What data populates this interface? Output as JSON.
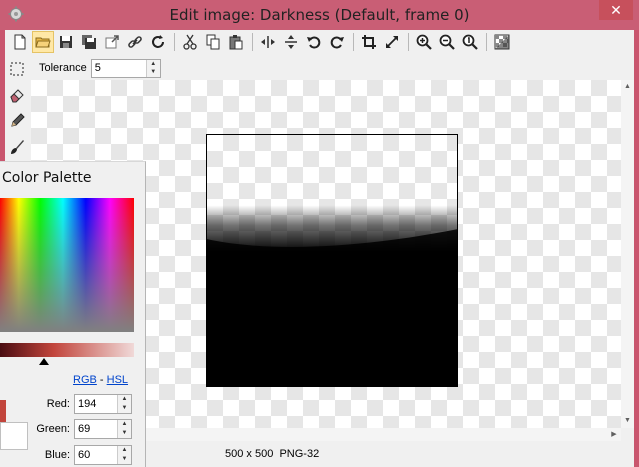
{
  "window": {
    "title": "Edit image: Darkness (Default, frame 0)",
    "close_glyph": "✕"
  },
  "toolbar": {
    "buttons": [
      {
        "icon": "new-file-icon"
      },
      {
        "icon": "open-folder-icon"
      },
      {
        "icon": "save-icon"
      },
      {
        "icon": "save-all-icon"
      },
      {
        "icon": "export-icon"
      },
      {
        "icon": "link-icon"
      },
      {
        "icon": "refresh-icon"
      },
      {
        "icon": "cut-icon"
      },
      {
        "icon": "copy-icon"
      },
      {
        "icon": "paste-icon"
      },
      {
        "icon": "flip-horizontal-icon"
      },
      {
        "icon": "flip-vertical-icon"
      },
      {
        "icon": "rotate-left-icon"
      },
      {
        "icon": "rotate-right-icon"
      },
      {
        "icon": "crop-icon"
      },
      {
        "icon": "resize-icon"
      },
      {
        "icon": "zoom-in-icon"
      },
      {
        "icon": "zoom-out-icon"
      },
      {
        "icon": "zoom-actual-icon"
      },
      {
        "icon": "transparency-icon"
      }
    ]
  },
  "options": {
    "tolerance_label": "Tolerance",
    "tolerance_value": "5"
  },
  "status": {
    "dimensions": "500 x 500",
    "format": "PNG-32"
  },
  "palette": {
    "title": "Color Palette",
    "mode_rgb": "RGB",
    "mode_separator": " - ",
    "mode_hsl": "HSL",
    "red_label": "Red:",
    "red_value": "194",
    "green_label": "Green:",
    "green_value": "69",
    "blue_label": "Blue:",
    "blue_value": "60",
    "current_color": "#c2453c"
  }
}
